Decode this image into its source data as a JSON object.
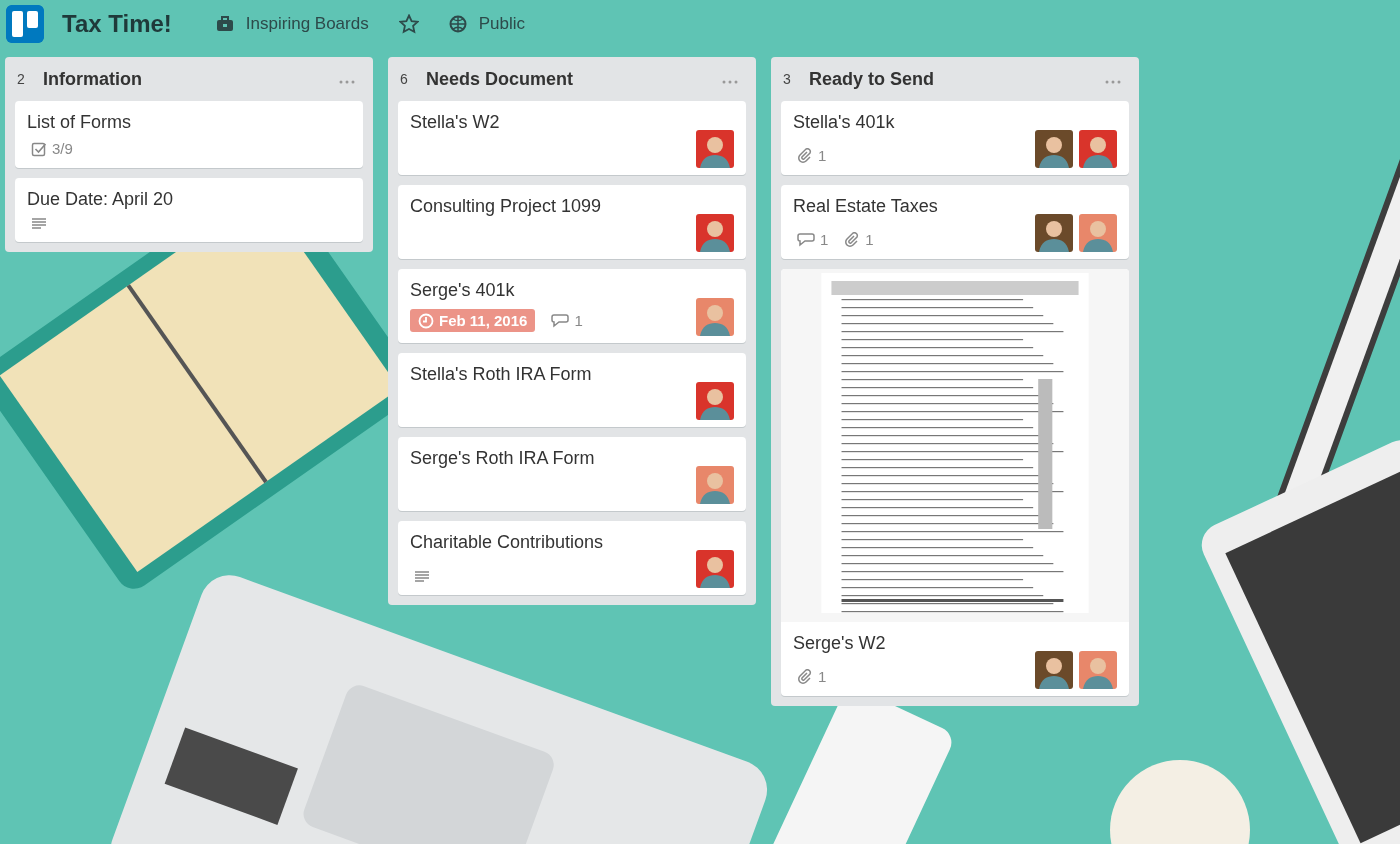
{
  "board": {
    "title": "Tax Time!",
    "team": "Inspiring Boards",
    "starred": false,
    "visibility": "Public"
  },
  "lists": [
    {
      "name": "Information",
      "count": "2",
      "cards": [
        {
          "title": "List of Forms",
          "badges": [
            {
              "kind": "checklist",
              "text": "3/9"
            }
          ]
        },
        {
          "title": "Due Date: April 20",
          "badges": [
            {
              "kind": "description"
            }
          ]
        }
      ]
    },
    {
      "name": "Needs Document",
      "count": "6",
      "cards": [
        {
          "title": "Stella's W2",
          "members": [
            {
              "color": "#d9342b"
            }
          ]
        },
        {
          "title": "Consulting Project 1099",
          "members": [
            {
              "color": "#d9342b"
            }
          ]
        },
        {
          "title": "Serge's 401k",
          "badges": [
            {
              "kind": "due",
              "text": "Feb 11, 2016",
              "color": "#ec9488"
            },
            {
              "kind": "comments",
              "text": "1"
            }
          ],
          "members": [
            {
              "color": "#e8876a"
            }
          ]
        },
        {
          "title": "Stella's Roth IRA Form",
          "members": [
            {
              "color": "#d9342b"
            }
          ]
        },
        {
          "title": "Serge's Roth IRA Form",
          "members": [
            {
              "color": "#e8876a"
            }
          ]
        },
        {
          "title": "Charitable Contributions",
          "badges": [
            {
              "kind": "description"
            }
          ],
          "members": [
            {
              "color": "#d9342b"
            }
          ]
        }
      ]
    },
    {
      "name": "Ready to Send",
      "count": "3",
      "cards": [
        {
          "title": "Stella's 401k",
          "badges": [
            {
              "kind": "attachments",
              "text": "1"
            }
          ],
          "members": [
            {
              "color": "#6b4a2a"
            },
            {
              "color": "#d9342b"
            }
          ]
        },
        {
          "title": "Real Estate Taxes",
          "badges": [
            {
              "kind": "comments",
              "text": "1"
            },
            {
              "kind": "attachments",
              "text": "1"
            }
          ],
          "members": [
            {
              "color": "#6b4a2a"
            },
            {
              "color": "#e8876a"
            }
          ]
        },
        {
          "cover": {
            "kind": "picture"
          },
          "title": "Serge's W2",
          "badges": [
            {
              "kind": "attachments",
              "text": "1"
            }
          ],
          "members": [
            {
              "color": "#6b4a2a"
            },
            {
              "color": "#e8876a"
            }
          ]
        }
      ]
    }
  ]
}
